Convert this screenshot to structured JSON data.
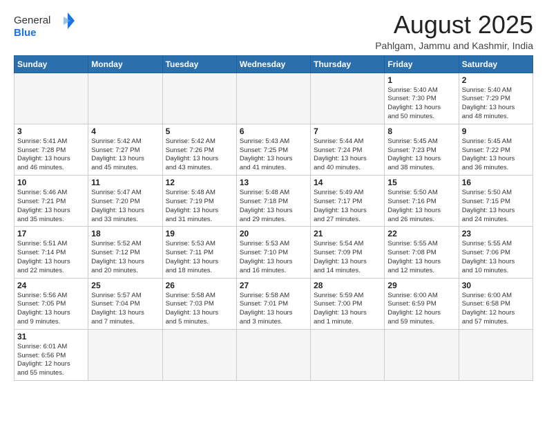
{
  "logo": {
    "text_general": "General",
    "text_blue": "Blue"
  },
  "title": "August 2025",
  "location": "Pahlgam, Jammu and Kashmir, India",
  "weekdays": [
    "Sunday",
    "Monday",
    "Tuesday",
    "Wednesday",
    "Thursday",
    "Friday",
    "Saturday"
  ],
  "weeks": [
    [
      {
        "day": "",
        "info": ""
      },
      {
        "day": "",
        "info": ""
      },
      {
        "day": "",
        "info": ""
      },
      {
        "day": "",
        "info": ""
      },
      {
        "day": "",
        "info": ""
      },
      {
        "day": "1",
        "info": "Sunrise: 5:40 AM\nSunset: 7:30 PM\nDaylight: 13 hours\nand 50 minutes."
      },
      {
        "day": "2",
        "info": "Sunrise: 5:40 AM\nSunset: 7:29 PM\nDaylight: 13 hours\nand 48 minutes."
      }
    ],
    [
      {
        "day": "3",
        "info": "Sunrise: 5:41 AM\nSunset: 7:28 PM\nDaylight: 13 hours\nand 46 minutes."
      },
      {
        "day": "4",
        "info": "Sunrise: 5:42 AM\nSunset: 7:27 PM\nDaylight: 13 hours\nand 45 minutes."
      },
      {
        "day": "5",
        "info": "Sunrise: 5:42 AM\nSunset: 7:26 PM\nDaylight: 13 hours\nand 43 minutes."
      },
      {
        "day": "6",
        "info": "Sunrise: 5:43 AM\nSunset: 7:25 PM\nDaylight: 13 hours\nand 41 minutes."
      },
      {
        "day": "7",
        "info": "Sunrise: 5:44 AM\nSunset: 7:24 PM\nDaylight: 13 hours\nand 40 minutes."
      },
      {
        "day": "8",
        "info": "Sunrise: 5:45 AM\nSunset: 7:23 PM\nDaylight: 13 hours\nand 38 minutes."
      },
      {
        "day": "9",
        "info": "Sunrise: 5:45 AM\nSunset: 7:22 PM\nDaylight: 13 hours\nand 36 minutes."
      }
    ],
    [
      {
        "day": "10",
        "info": "Sunrise: 5:46 AM\nSunset: 7:21 PM\nDaylight: 13 hours\nand 35 minutes."
      },
      {
        "day": "11",
        "info": "Sunrise: 5:47 AM\nSunset: 7:20 PM\nDaylight: 13 hours\nand 33 minutes."
      },
      {
        "day": "12",
        "info": "Sunrise: 5:48 AM\nSunset: 7:19 PM\nDaylight: 13 hours\nand 31 minutes."
      },
      {
        "day": "13",
        "info": "Sunrise: 5:48 AM\nSunset: 7:18 PM\nDaylight: 13 hours\nand 29 minutes."
      },
      {
        "day": "14",
        "info": "Sunrise: 5:49 AM\nSunset: 7:17 PM\nDaylight: 13 hours\nand 27 minutes."
      },
      {
        "day": "15",
        "info": "Sunrise: 5:50 AM\nSunset: 7:16 PM\nDaylight: 13 hours\nand 26 minutes."
      },
      {
        "day": "16",
        "info": "Sunrise: 5:50 AM\nSunset: 7:15 PM\nDaylight: 13 hours\nand 24 minutes."
      }
    ],
    [
      {
        "day": "17",
        "info": "Sunrise: 5:51 AM\nSunset: 7:14 PM\nDaylight: 13 hours\nand 22 minutes."
      },
      {
        "day": "18",
        "info": "Sunrise: 5:52 AM\nSunset: 7:12 PM\nDaylight: 13 hours\nand 20 minutes."
      },
      {
        "day": "19",
        "info": "Sunrise: 5:53 AM\nSunset: 7:11 PM\nDaylight: 13 hours\nand 18 minutes."
      },
      {
        "day": "20",
        "info": "Sunrise: 5:53 AM\nSunset: 7:10 PM\nDaylight: 13 hours\nand 16 minutes."
      },
      {
        "day": "21",
        "info": "Sunrise: 5:54 AM\nSunset: 7:09 PM\nDaylight: 13 hours\nand 14 minutes."
      },
      {
        "day": "22",
        "info": "Sunrise: 5:55 AM\nSunset: 7:08 PM\nDaylight: 13 hours\nand 12 minutes."
      },
      {
        "day": "23",
        "info": "Sunrise: 5:55 AM\nSunset: 7:06 PM\nDaylight: 13 hours\nand 10 minutes."
      }
    ],
    [
      {
        "day": "24",
        "info": "Sunrise: 5:56 AM\nSunset: 7:05 PM\nDaylight: 13 hours\nand 9 minutes."
      },
      {
        "day": "25",
        "info": "Sunrise: 5:57 AM\nSunset: 7:04 PM\nDaylight: 13 hours\nand 7 minutes."
      },
      {
        "day": "26",
        "info": "Sunrise: 5:58 AM\nSunset: 7:03 PM\nDaylight: 13 hours\nand 5 minutes."
      },
      {
        "day": "27",
        "info": "Sunrise: 5:58 AM\nSunset: 7:01 PM\nDaylight: 13 hours\nand 3 minutes."
      },
      {
        "day": "28",
        "info": "Sunrise: 5:59 AM\nSunset: 7:00 PM\nDaylight: 13 hours\nand 1 minute."
      },
      {
        "day": "29",
        "info": "Sunrise: 6:00 AM\nSunset: 6:59 PM\nDaylight: 12 hours\nand 59 minutes."
      },
      {
        "day": "30",
        "info": "Sunrise: 6:00 AM\nSunset: 6:58 PM\nDaylight: 12 hours\nand 57 minutes."
      }
    ],
    [
      {
        "day": "31",
        "info": "Sunrise: 6:01 AM\nSunset: 6:56 PM\nDaylight: 12 hours\nand 55 minutes."
      },
      {
        "day": "",
        "info": ""
      },
      {
        "day": "",
        "info": ""
      },
      {
        "day": "",
        "info": ""
      },
      {
        "day": "",
        "info": ""
      },
      {
        "day": "",
        "info": ""
      },
      {
        "day": "",
        "info": ""
      }
    ]
  ]
}
